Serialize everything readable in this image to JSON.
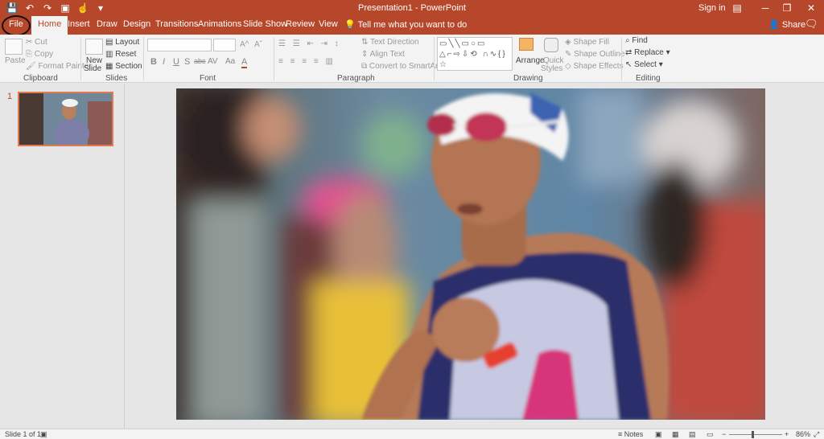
{
  "titlebar": {
    "doc_title": "Presentation1 - PowerPoint",
    "signin": "Sign in",
    "qat_icons": [
      "save-icon",
      "undo-icon",
      "redo-icon",
      "start-from-beginning-icon",
      "touch-mode-icon",
      "customize-icon"
    ],
    "window_controls": [
      "ribbon-display-icon",
      "minimize-icon",
      "restore-icon",
      "close-icon"
    ]
  },
  "tabs": [
    {
      "label": "File"
    },
    {
      "label": "Home"
    },
    {
      "label": "Insert"
    },
    {
      "label": "Draw"
    },
    {
      "label": "Design"
    },
    {
      "label": "Transitions"
    },
    {
      "label": "Animations"
    },
    {
      "label": "Slide Show"
    },
    {
      "label": "Review"
    },
    {
      "label": "View"
    }
  ],
  "active_tab": "Home",
  "tellme": "Tell me what you want to do",
  "share": "Share",
  "ribbon": {
    "clipboard": {
      "label": "Clipboard",
      "paste": "Paste",
      "cut": "Cut",
      "copy": "Copy",
      "format_painter": "Format Painter"
    },
    "slides": {
      "label": "Slides",
      "new_slide_1": "New",
      "new_slide_2": "Slide",
      "layout": "Layout",
      "reset": "Reset",
      "section": "Section"
    },
    "font": {
      "label": "Font",
      "bold": "B",
      "italic": "I",
      "underline": "U",
      "shadow": "S",
      "strike": "abc",
      "spacing": "AV",
      "case": "Aa",
      "color": "A"
    },
    "paragraph": {
      "label": "Paragraph",
      "text_direction": "Text Direction",
      "align_text": "Align Text",
      "convert_smartart": "Convert to SmartArt"
    },
    "drawing": {
      "label": "Drawing",
      "arrange": "Arrange",
      "quick_styles_1": "Quick",
      "quick_styles_2": "Styles",
      "shape_fill": "Shape Fill",
      "shape_outline": "Shape Outline",
      "shape_effects": "Shape Effects",
      "shapes_glyphs": "▭╲╲▭○▭ △⌐⇨⇩⟲ ∩∿{}☆"
    },
    "editing": {
      "label": "Editing",
      "find": "Find",
      "replace": "Replace",
      "select": "Select"
    }
  },
  "thumbnails": [
    {
      "number": "1"
    }
  ],
  "statusbar": {
    "slide_info": "Slide 1 of 1",
    "notes": "Notes",
    "zoom": "86%"
  }
}
